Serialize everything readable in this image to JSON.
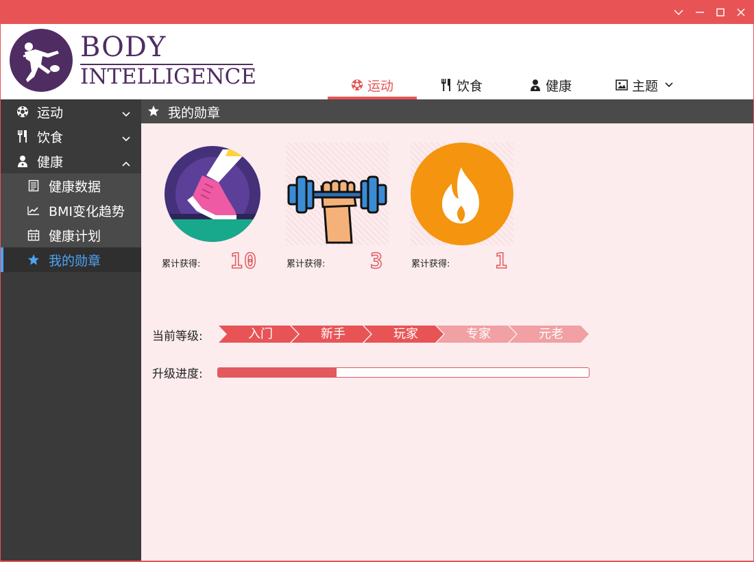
{
  "window": {
    "controls": [
      "chevron-down-icon",
      "minimize-icon",
      "maximize-icon",
      "close-icon"
    ]
  },
  "logo": {
    "line1": "BODY",
    "line2": "INTELLIGENCE"
  },
  "nav": {
    "tabs": [
      {
        "label": "运动",
        "icon": "soccer-ball-icon",
        "active": true
      },
      {
        "label": "饮食",
        "icon": "fork-knife-icon",
        "active": false
      },
      {
        "label": "健康",
        "icon": "doctor-icon",
        "active": false
      },
      {
        "label": "主题",
        "icon": "image-icon",
        "active": false,
        "dropdown": true
      }
    ]
  },
  "sidebar": {
    "items": [
      {
        "label": "运动",
        "icon": "soccer-ball-icon",
        "expanded": false
      },
      {
        "label": "饮食",
        "icon": "fork-knife-icon",
        "expanded": false
      },
      {
        "label": "健康",
        "icon": "doctor-icon",
        "expanded": true
      }
    ],
    "subitems": [
      {
        "label": "健康数据",
        "icon": "document-icon"
      },
      {
        "label": "BMI变化趋势",
        "icon": "line-chart-icon"
      },
      {
        "label": "健康计划",
        "icon": "calendar-icon"
      },
      {
        "label": "我的勋章",
        "icon": "star-icon",
        "selected": true
      }
    ]
  },
  "main": {
    "title": "我的勋章",
    "badges": [
      {
        "name": "running-badge",
        "label": "累计获得:",
        "count": "10"
      },
      {
        "name": "strength-badge",
        "label": "累计获得:",
        "count": "3"
      },
      {
        "name": "fire-badge",
        "label": "累计获得:",
        "count": "1"
      }
    ],
    "level": {
      "label": "当前等级:",
      "steps": [
        "入门",
        "新手",
        "玩家",
        "专家",
        "元老"
      ],
      "current_index": 2
    },
    "progress": {
      "label": "升级进度:",
      "value": 0.32
    }
  },
  "colors": {
    "accent": "#e85455",
    "sidebar": "#3a3a3a",
    "selected": "#4da3f4",
    "content_bg": "#fcecee",
    "logo": "#4f2d63"
  }
}
